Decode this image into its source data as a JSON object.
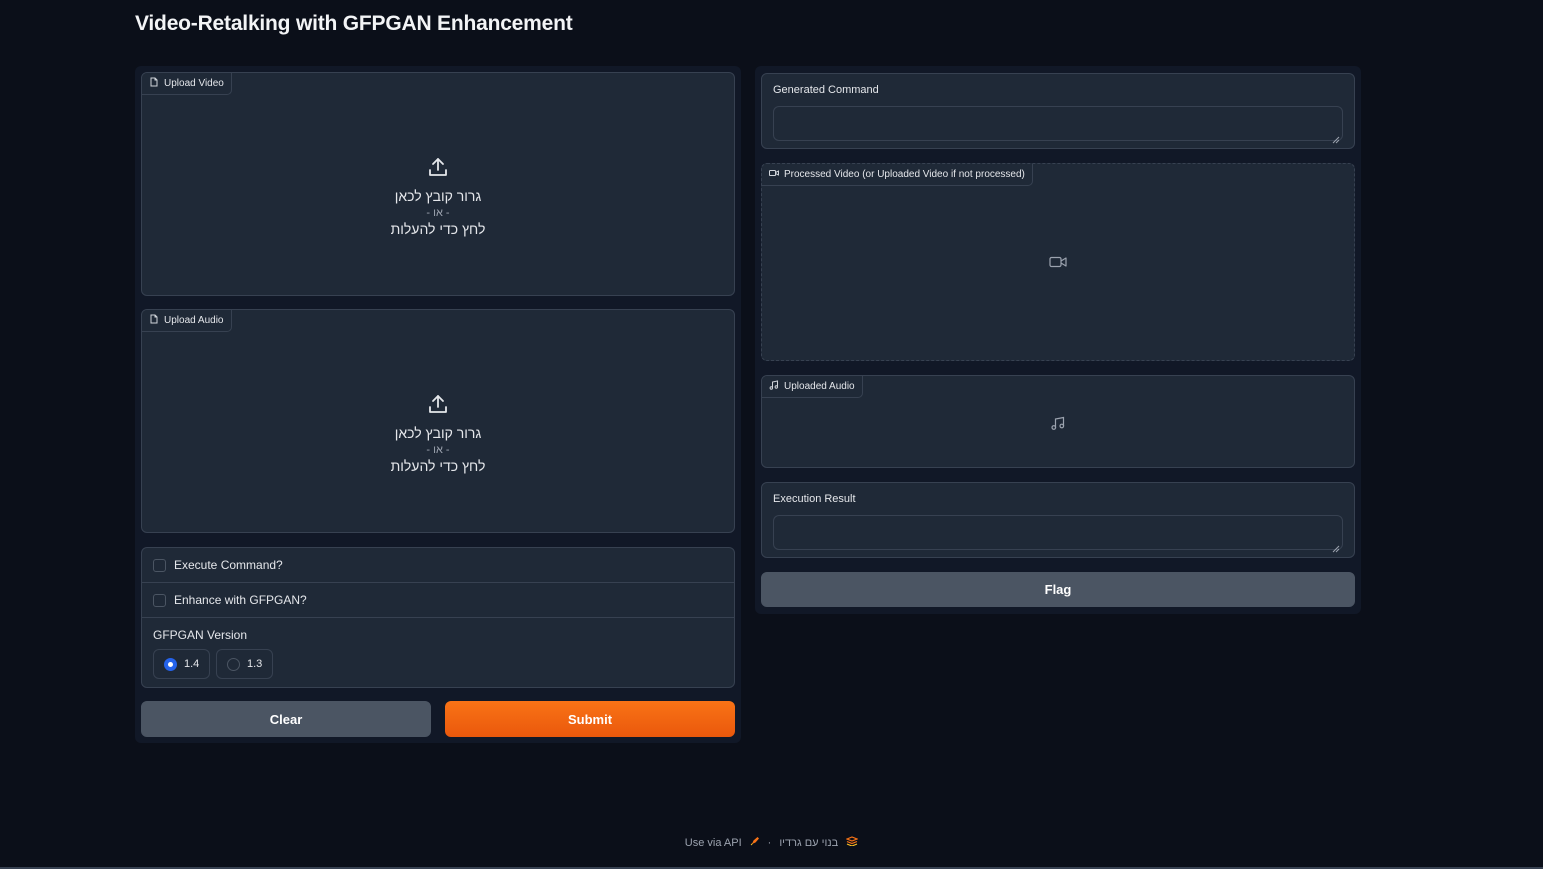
{
  "app": {
    "title": "Video-Retalking with GFPGAN Enhancement"
  },
  "inputs": {
    "upload_video": {
      "label": "Upload Video",
      "drop_text": "גרור קובץ לכאן",
      "or_text": "- או -",
      "click_text": "לחץ כדי להעלות"
    },
    "upload_audio": {
      "label": "Upload Audio",
      "drop_text": "גרור קובץ לכאן",
      "or_text": "- או -",
      "click_text": "לחץ כדי להעלות"
    },
    "execute_command": {
      "label": "Execute Command?",
      "checked": false
    },
    "enhance_gfpgan": {
      "label": "Enhance with GFPGAN?",
      "checked": false
    },
    "gfpgan_version": {
      "label": "GFPGAN Version",
      "options": [
        "1.4",
        "1.3"
      ],
      "selected": "1.4"
    },
    "clear_label": "Clear",
    "submit_label": "Submit"
  },
  "outputs": {
    "generated_command": {
      "label": "Generated Command",
      "value": ""
    },
    "processed_video": {
      "label": "Processed Video (or Uploaded Video if not processed)"
    },
    "uploaded_audio": {
      "label": "Uploaded Audio"
    },
    "execution_result": {
      "label": "Execution Result",
      "value": ""
    },
    "flag_label": "Flag"
  },
  "footer": {
    "api_text": "Use via API",
    "separator": "·",
    "built_with": "בנוי עם גרדיו"
  },
  "colors": {
    "background": "#0b0f19",
    "panel": "#1f2937",
    "border": "#374151",
    "primary": "#f97316",
    "radio_selected": "#2563eb"
  }
}
